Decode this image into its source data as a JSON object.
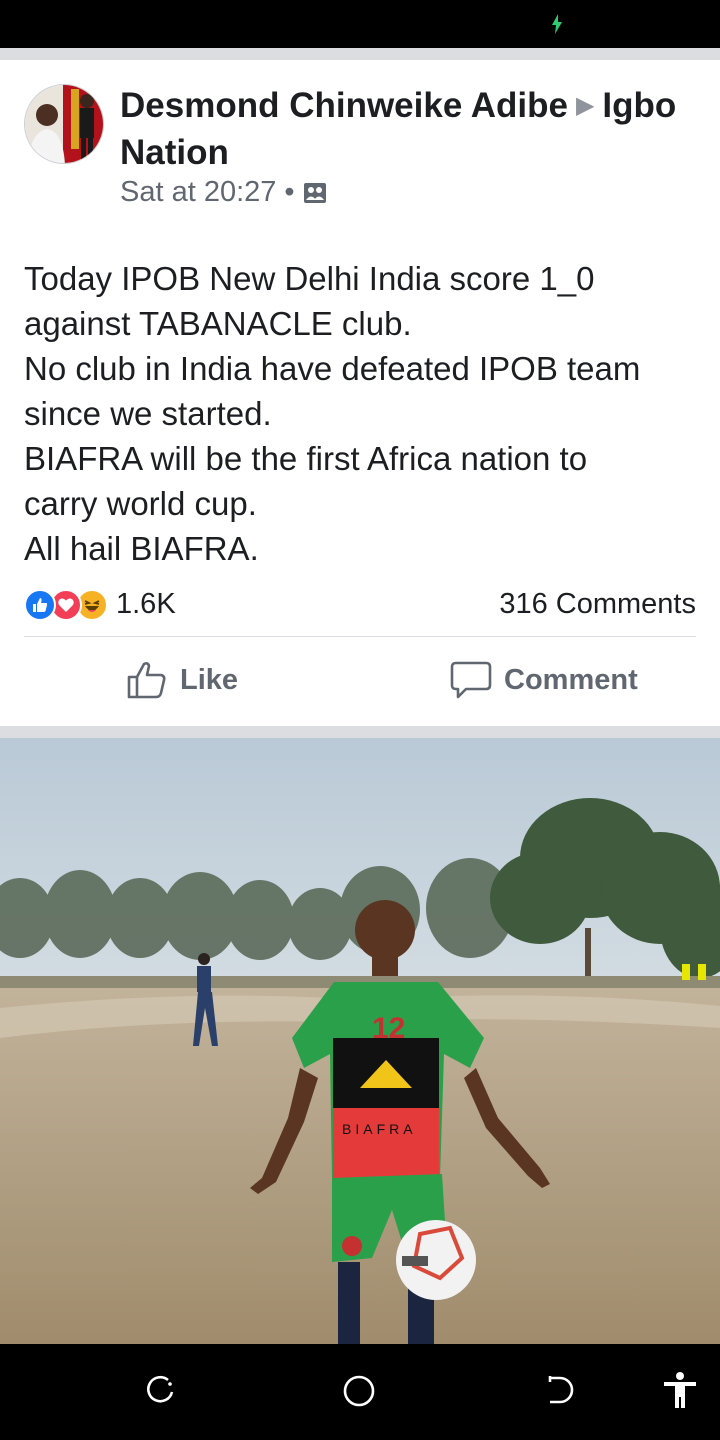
{
  "post": {
    "author": "Desmond Chinweike Adibe",
    "group": "Igbo Nation",
    "timestamp": "Sat at 20:27",
    "audience_icon": "group-icon",
    "text_lines": [
      "Today IPOB New Delhi India score 1_0",
      "against TABANACLE club.",
      "No club in India have defeated IPOB team",
      "since we started.",
      "BIAFRA will be the first Africa nation to",
      "carry world cup.",
      "All hail BIAFRA."
    ],
    "reaction_icons": [
      "like-reaction-icon",
      "love-reaction-icon",
      "haha-reaction-icon"
    ],
    "reaction_count": "1.6K",
    "comment_count": "316 Comments"
  },
  "actions": {
    "like_label": "Like",
    "comment_label": "Comment"
  },
  "photo": {
    "jersey_number": "12",
    "jersey_text": "BIAFRA"
  },
  "colors": {
    "like_blue": "#1877f2",
    "love_red": "#f33e58",
    "haha_yellow": "#f7b125",
    "charge_green": "#2ecc71"
  }
}
